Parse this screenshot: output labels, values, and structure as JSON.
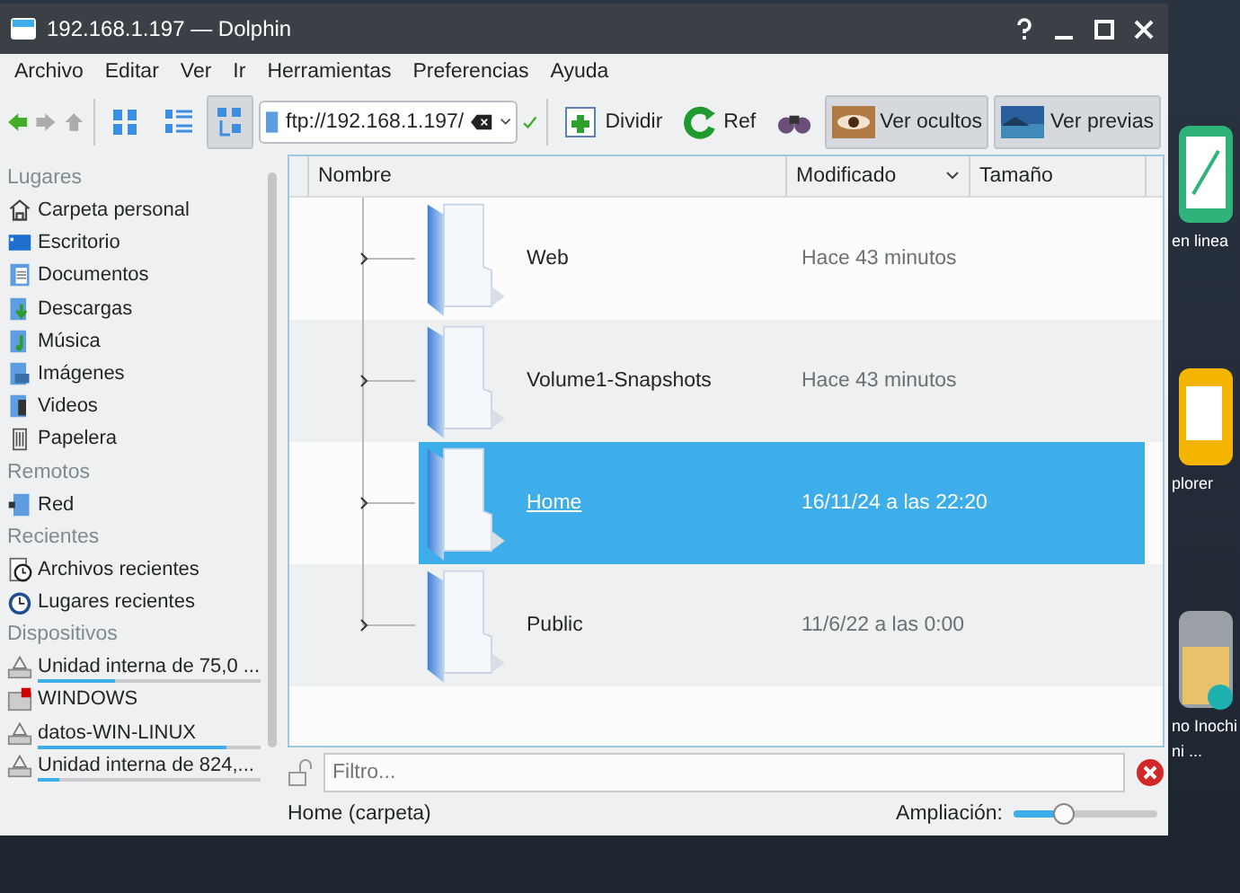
{
  "window": {
    "title": "192.168.1.197 — Dolphin"
  },
  "menu": [
    "Archivo",
    "Editar",
    "Ver",
    "Ir",
    "Herramientas",
    "Preferencias",
    "Ayuda"
  ],
  "toolbar": {
    "view_modes": [
      {
        "kind": "icons",
        "selected": false
      },
      {
        "kind": "compact",
        "selected": false
      },
      {
        "kind": "details",
        "selected": true
      }
    ],
    "location": "ftp://192.168.1.197/",
    "buttons": [
      {
        "kind": "split",
        "label": "Dividir",
        "selected": false
      },
      {
        "kind": "reload",
        "label": "Ref",
        "selected": false
      },
      {
        "kind": "find",
        "selected": false
      },
      {
        "kind": "hidden",
        "label": "Ver ocultos",
        "selected": true
      },
      {
        "kind": "preview",
        "label": "Ver previas",
        "selected": true
      }
    ]
  },
  "sidebar": [
    {
      "title": "Lugares",
      "items": [
        {
          "kind": "home",
          "label": "Carpeta personal"
        },
        {
          "kind": "desktop",
          "label": "Escritorio"
        },
        {
          "kind": "documents",
          "label": "Documentos"
        },
        {
          "kind": "downloads",
          "label": "Descargas"
        },
        {
          "kind": "music",
          "label": "Música"
        },
        {
          "kind": "images",
          "label": "Imágenes"
        },
        {
          "kind": "videos",
          "label": "Videos"
        },
        {
          "kind": "trash",
          "label": "Papelera"
        }
      ]
    },
    {
      "title": "Remotos",
      "items": [
        {
          "kind": "network",
          "label": "Red"
        }
      ]
    },
    {
      "title": "Recientes",
      "items": [
        {
          "kind": "recent-files",
          "label": "Archivos recientes"
        },
        {
          "kind": "recent-places",
          "label": "Lugares recientes"
        }
      ]
    },
    {
      "title": "Dispositivos",
      "items": [
        {
          "kind": "drive",
          "label": "Unidad interna de 75,0 ...",
          "level": 0.35
        },
        {
          "kind": "windows-drive",
          "label": "WINDOWS"
        },
        {
          "kind": "drive",
          "label": "datos-WIN-LINUX",
          "level": 0.85
        },
        {
          "kind": "drive",
          "label": "Unidad interna de 824,...",
          "level": 0.1
        }
      ]
    }
  ],
  "table": {
    "columns": [
      {
        "label": "Nombre",
        "sorted": false
      },
      {
        "label": "Modificado",
        "sorted": true
      },
      {
        "label": "Tamaño",
        "sorted": false
      }
    ],
    "rows": [
      {
        "name": "Web",
        "modified": "Hace 43 minutos",
        "selected": false
      },
      {
        "name": "Volume1-Snapshots",
        "modified": "Hace 43 minutos",
        "selected": false
      },
      {
        "name": "Home",
        "modified": "16/11/24 a las 22:20",
        "selected": true
      },
      {
        "name": "Public",
        "modified": "11/6/22 a las 0:00",
        "selected": false
      }
    ]
  },
  "filter": {
    "placeholder": "Filtro..."
  },
  "status_bar": {
    "text": "Home (carpeta)",
    "zoom": {
      "label": "Ampliación:",
      "level": 0.35
    }
  },
  "desktop": [
    {
      "kind": "compass",
      "lines": [
        "en linea"
      ]
    },
    {
      "kind": "document",
      "lines": [
        "plorer"
      ]
    },
    {
      "kind": "folder",
      "lines": [
        "no Inochi",
        "ni ..."
      ]
    }
  ]
}
